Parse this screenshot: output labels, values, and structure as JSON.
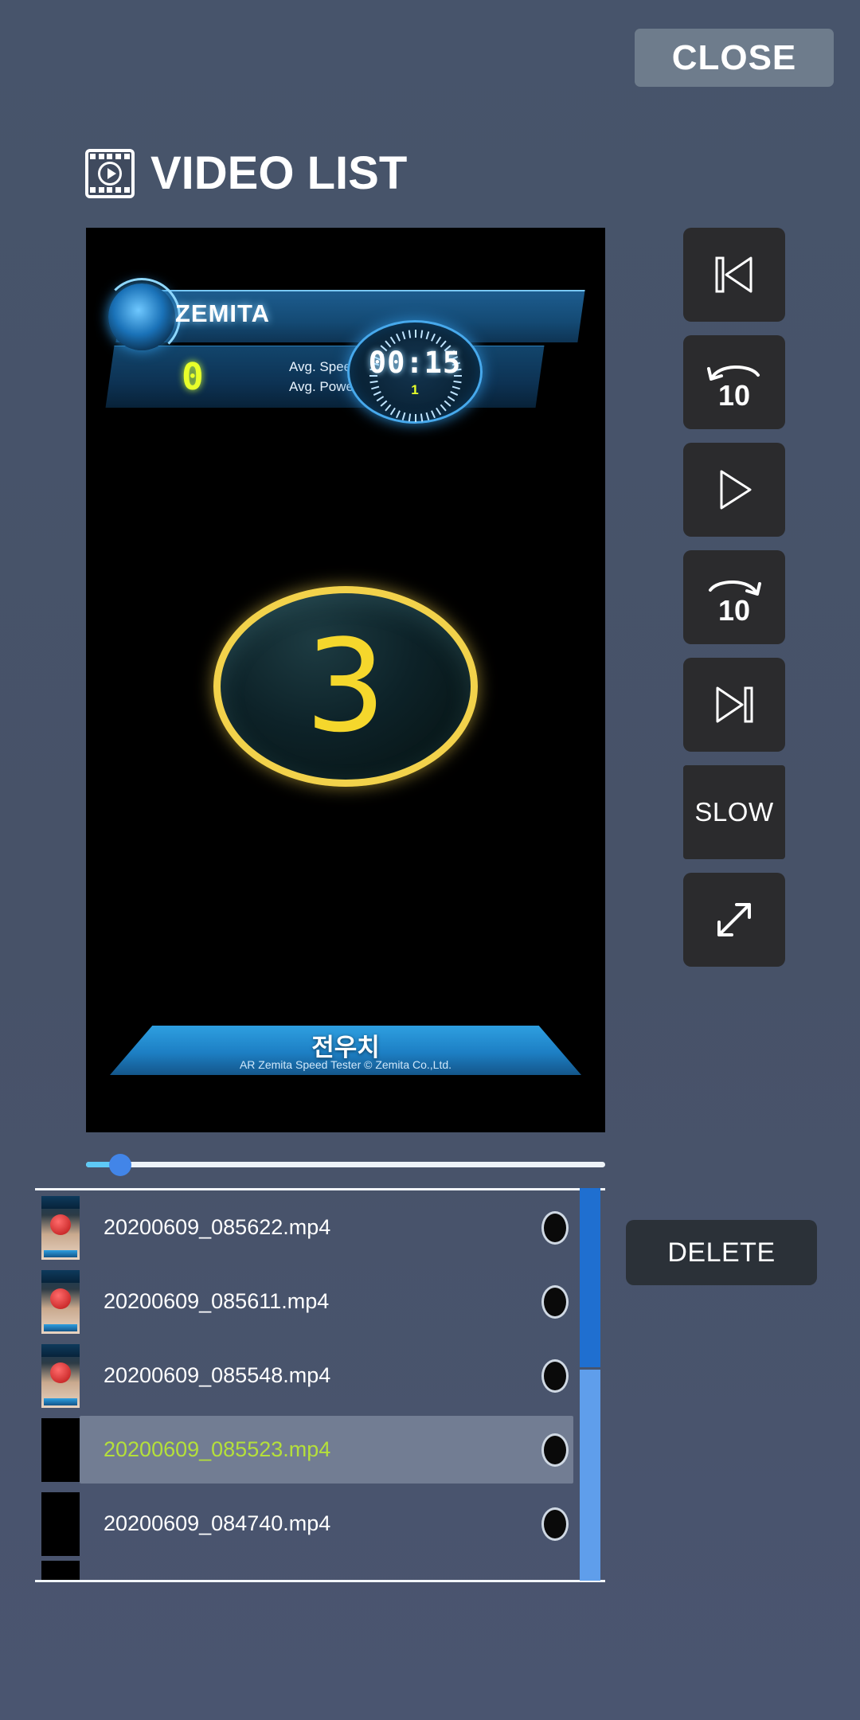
{
  "header": {
    "close_label": "CLOSE",
    "title": "VIDEO LIST",
    "title_icon": "film-play-icon"
  },
  "player": {
    "hud": {
      "app_name": "ZEMITA",
      "speed_label": "Avg. Speed:",
      "speed_value": "0.000",
      "power_label": "Avg. Power:",
      "power_value": "0.000",
      "counter_value": "0",
      "timer_value": "00:15",
      "timer_sub": "1"
    },
    "countdown": "3",
    "banner_title": "전우치",
    "banner_copyright": "AR Zemita Speed Tester © Zemita Co.,Ltd.",
    "seek_percent": 6
  },
  "controls": [
    {
      "name": "skip-to-start-button",
      "icon": "skip-start-icon",
      "label": ""
    },
    {
      "name": "rewind-10-button",
      "icon": "rewind-10-icon",
      "label": "10"
    },
    {
      "name": "play-button",
      "icon": "play-icon",
      "label": ""
    },
    {
      "name": "forward-10-button",
      "icon": "forward-10-icon",
      "label": "10"
    },
    {
      "name": "skip-to-end-button",
      "icon": "skip-end-icon",
      "label": ""
    },
    {
      "name": "slow-button",
      "icon": "slow-text-icon",
      "label": "SLOW"
    },
    {
      "name": "fullscreen-button",
      "icon": "expand-diagonal-icon",
      "label": ""
    }
  ],
  "video_list": {
    "items": [
      {
        "filename": "20200609_085622.mp4",
        "selected": false,
        "thumb": "photo"
      },
      {
        "filename": "20200609_085611.mp4",
        "selected": false,
        "thumb": "photo"
      },
      {
        "filename": "20200609_085548.mp4",
        "selected": false,
        "thumb": "photo"
      },
      {
        "filename": "20200609_085523.mp4",
        "selected": true,
        "thumb": "dark"
      },
      {
        "filename": "20200609_084740.mp4",
        "selected": false,
        "thumb": "dark"
      }
    ]
  },
  "actions": {
    "delete_label": "DELETE"
  },
  "colors": {
    "page_background": "#475569",
    "button_dark": "#2b2b2d",
    "accent_blue": "#4285e8",
    "selected_text": "#b5e03a",
    "hud_yellow": "#e8ff2a",
    "countdown_gold": "#f5d72c"
  }
}
